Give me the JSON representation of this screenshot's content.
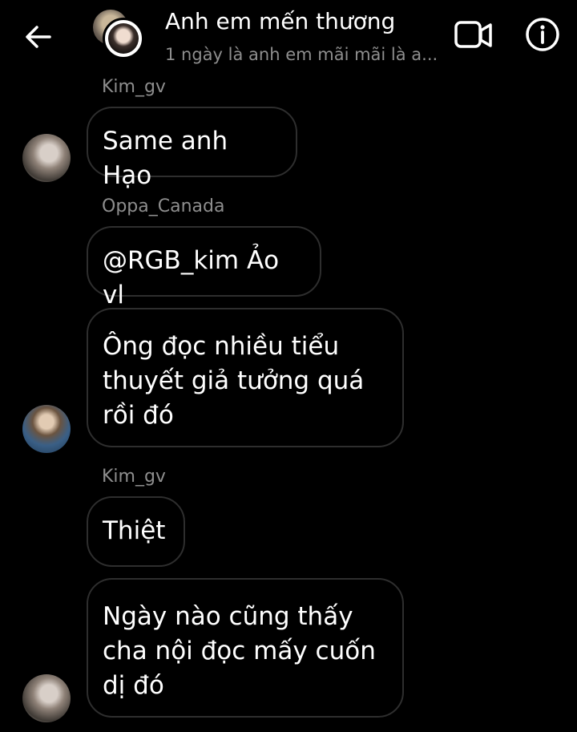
{
  "header": {
    "title": "Anh em mến thương",
    "subtitle": "1 ngày là anh em mãi mãi là a..."
  },
  "messages": [
    {
      "sender": "Kim_gv",
      "text": "Same anh Hạo"
    },
    {
      "sender": "Oppa_Canada",
      "text": "@RGB_kim Ảo vl"
    },
    {
      "text_lines": [
        "Ông đọc nhiều tiểu",
        "thuyết giả tưởng quá",
        "rồi đó"
      ]
    },
    {
      "sender": "Kim_gv",
      "text": "Thiệt"
    },
    {
      "text_lines": [
        "Ngày nào cũng thấy",
        "cha nội đọc mấy cuốn",
        "dị đó"
      ]
    }
  ],
  "icons": {
    "back": "arrow-left-icon",
    "video": "video-call-icon",
    "info": "info-icon"
  }
}
